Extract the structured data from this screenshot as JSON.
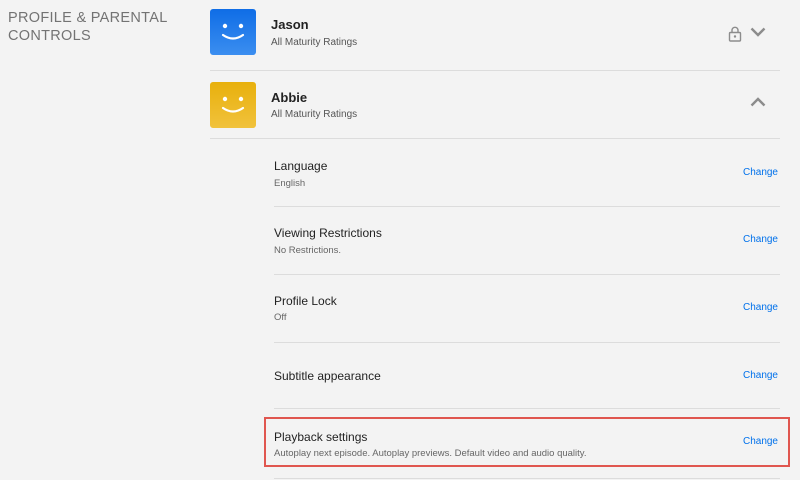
{
  "section": {
    "title": "PROFILE & PARENTAL CONTROLS"
  },
  "profiles": [
    {
      "name": "Jason",
      "subtitle": "All Maturity Ratings",
      "avatar_color": "#1a73e8",
      "icons": [
        "lock-icon",
        "chevron-down-icon"
      ],
      "expanded": false
    },
    {
      "name": "Abbie",
      "subtitle": "All Maturity Ratings",
      "avatar_color": "#e8b00c",
      "icons": [
        "chevron-up-icon"
      ],
      "expanded": true
    }
  ],
  "settings": [
    {
      "label": "Language",
      "value": "English",
      "action": "Change"
    },
    {
      "label": "Viewing Restrictions",
      "value": "No Restrictions.",
      "action": "Change"
    },
    {
      "label": "Profile Lock",
      "value": "Off",
      "action": "Change"
    },
    {
      "label": "Subtitle appearance",
      "value": "",
      "action": "Change"
    },
    {
      "label": "Playback settings",
      "value": "Autoplay next episode. Autoplay previews. Default video and audio quality.",
      "action": "Change",
      "highlighted": true
    }
  ],
  "colors": {
    "link": "#0071eb",
    "highlight": "#e0564f",
    "background": "#f3f3f3"
  }
}
